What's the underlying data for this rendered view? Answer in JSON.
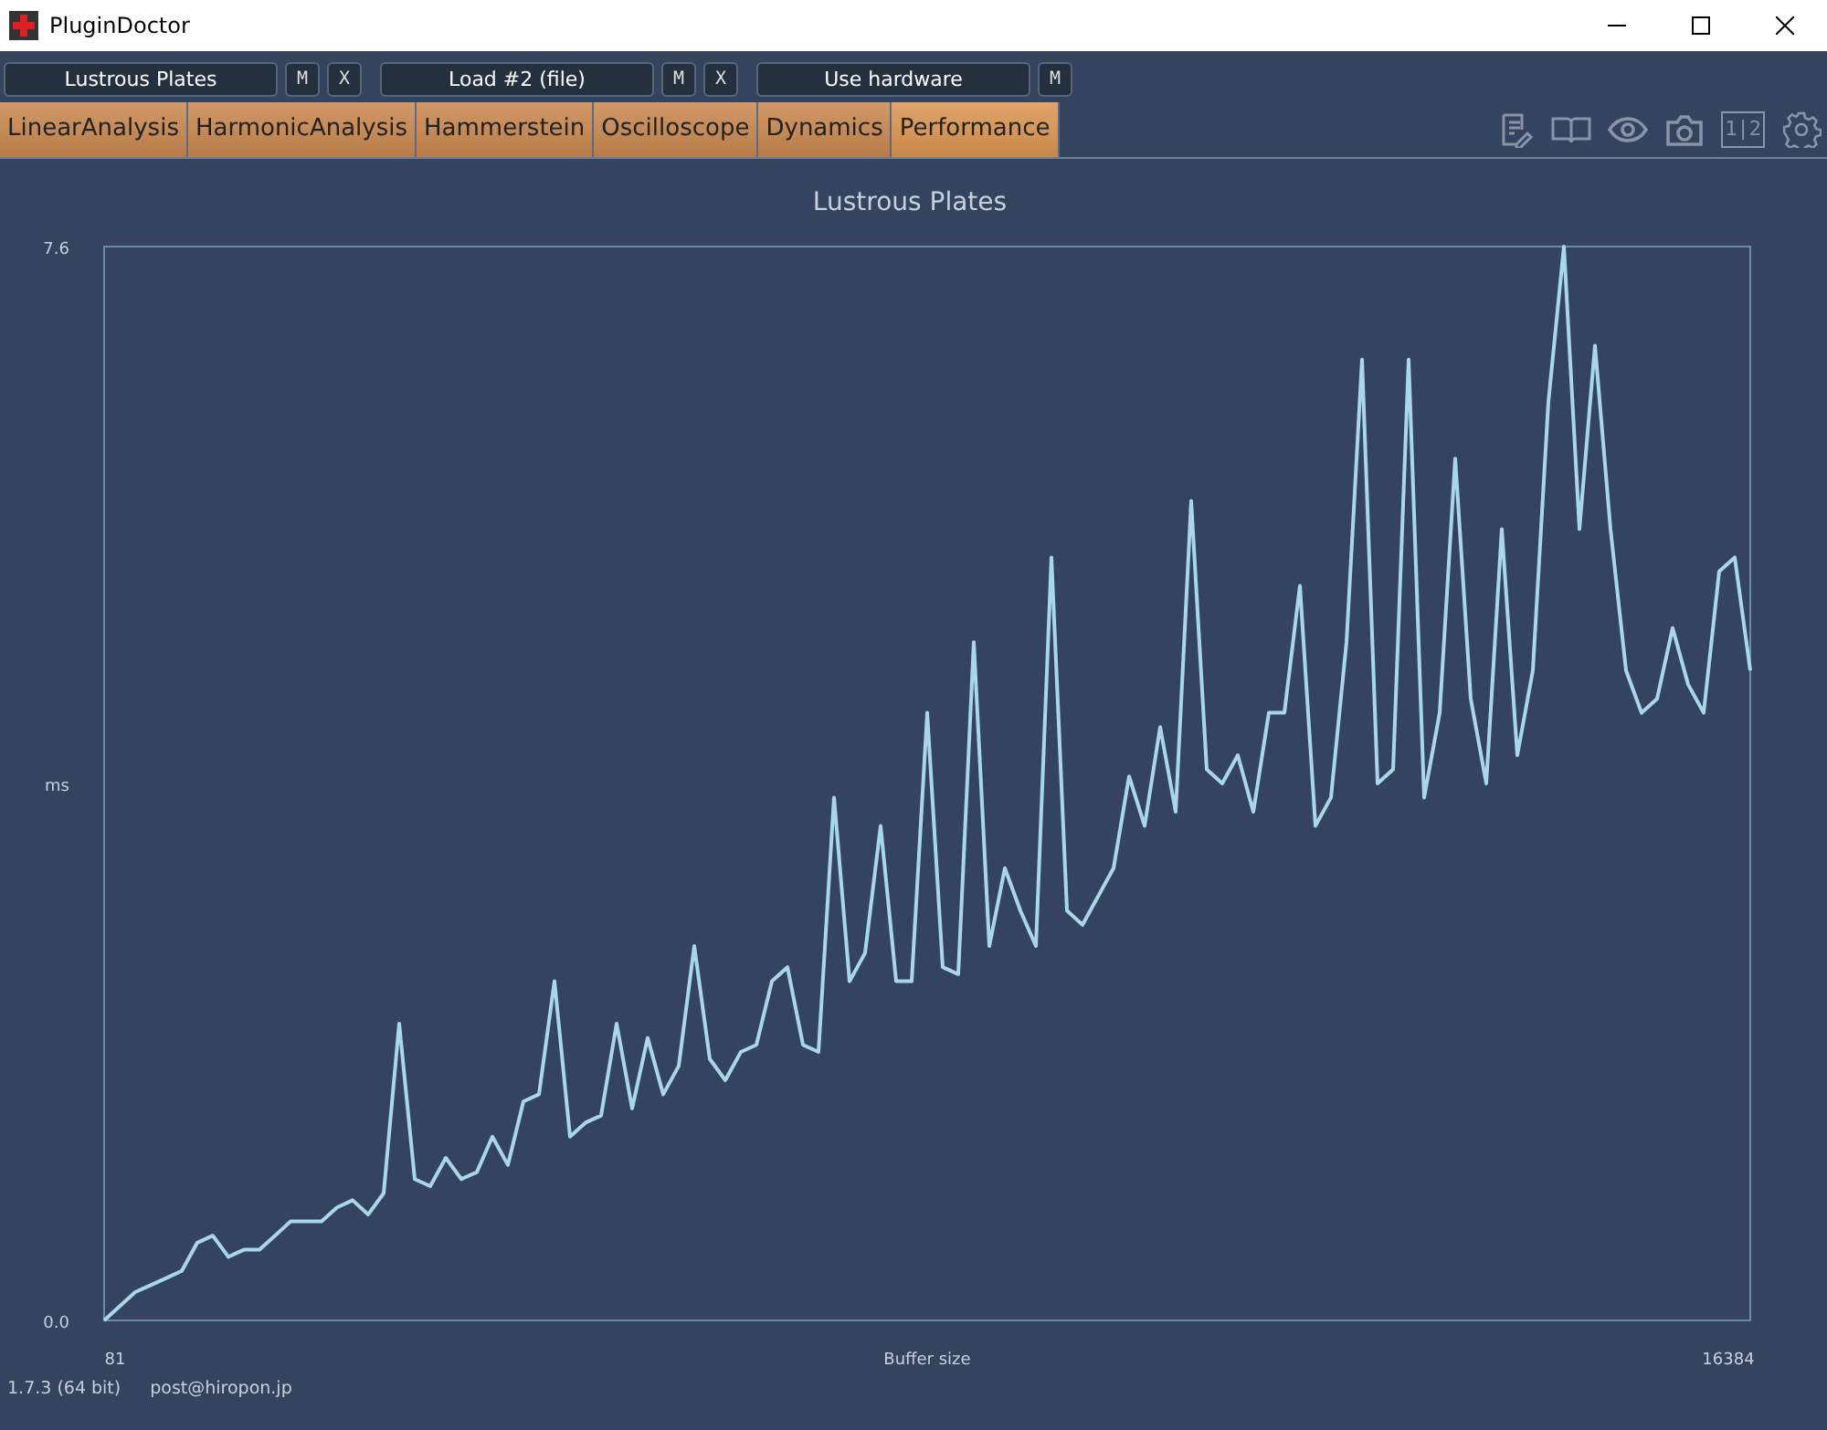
{
  "window": {
    "title": "PluginDoctor"
  },
  "slots": [
    {
      "label": "Lustrous Plates",
      "buttons": [
        "M",
        "X"
      ]
    },
    {
      "label": "Load #2 (file)",
      "buttons": [
        "M",
        "X"
      ]
    },
    {
      "label": "Use hardware",
      "buttons": [
        "M"
      ]
    }
  ],
  "tabs": [
    {
      "label": "LinearAnalysis",
      "selected": false
    },
    {
      "label": "HarmonicAnalysis",
      "selected": false
    },
    {
      "label": "Hammerstein",
      "selected": false
    },
    {
      "label": "Oscilloscope",
      "selected": false
    },
    {
      "label": "Dynamics",
      "selected": false
    },
    {
      "label": "Performance",
      "selected": true
    }
  ],
  "toolbar": {
    "compare_label": "1|2"
  },
  "x_axis": {
    "start_label": "81",
    "end_label": "16384"
  },
  "chart_data": {
    "type": "line",
    "title": "Lustrous Plates",
    "xlabel": "Buffer size",
    "ylabel": "ms",
    "ylim": [
      0,
      7.6
    ],
    "yticks": [
      {
        "value": 0,
        "label": "0.0"
      },
      {
        "value": 7.6,
        "label": "7.6"
      }
    ],
    "series": [
      {
        "color": "#a8d8e8",
        "values": [
          0.0,
          0.1,
          0.2,
          0.25,
          0.3,
          0.35,
          0.55,
          0.6,
          0.45,
          0.5,
          0.5,
          0.6,
          0.7,
          0.7,
          0.7,
          0.8,
          0.85,
          0.75,
          0.9,
          2.1,
          1.0,
          0.95,
          1.15,
          1.0,
          1.05,
          1.3,
          1.1,
          1.55,
          1.6,
          2.4,
          1.3,
          1.4,
          1.45,
          2.1,
          1.5,
          2.0,
          1.6,
          1.8,
          2.65,
          1.85,
          1.7,
          1.9,
          1.95,
          2.4,
          2.5,
          1.95,
          1.9,
          3.7,
          2.4,
          2.6,
          3.5,
          2.4,
          2.4,
          4.3,
          2.5,
          2.45,
          4.8,
          2.65,
          3.2,
          2.9,
          2.65,
          5.4,
          2.9,
          2.8,
          3.0,
          3.2,
          3.85,
          3.5,
          4.2,
          3.6,
          5.8,
          3.9,
          3.8,
          4.0,
          3.6,
          4.3,
          4.3,
          5.2,
          3.5,
          3.7,
          4.8,
          6.8,
          3.8,
          3.9,
          6.8,
          3.7,
          4.3,
          6.1,
          4.4,
          3.8,
          5.6,
          4.0,
          4.6,
          6.5,
          7.6,
          5.6,
          6.9,
          5.6,
          4.6,
          4.3,
          4.4,
          4.9,
          4.5,
          4.3,
          5.3,
          5.4,
          4.6
        ]
      }
    ]
  },
  "status_bar": {
    "version": "1.7.3 (64 bit)",
    "contact": "post@hiropon.jp"
  }
}
